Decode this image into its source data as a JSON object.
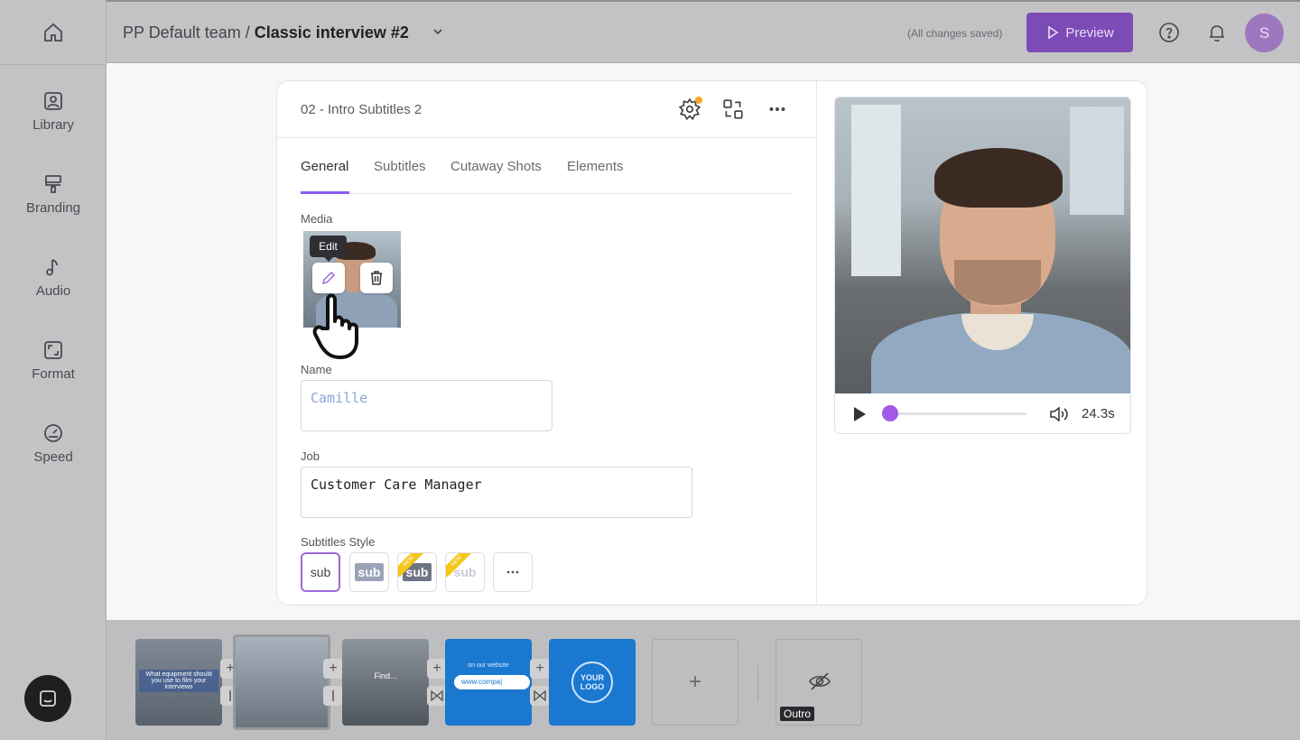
{
  "sidebar": {
    "items": [
      {
        "label": "Library",
        "icon": "image-icon"
      },
      {
        "label": "Branding",
        "icon": "paint-roller-icon"
      },
      {
        "label": "Audio",
        "icon": "music-note-icon"
      },
      {
        "label": "Format",
        "icon": "aspect-ratio-icon"
      },
      {
        "label": "Speed",
        "icon": "speedometer-icon"
      }
    ]
  },
  "header": {
    "team": "PP Default team",
    "separator": " / ",
    "project": "Classic interview #2",
    "saved_status": "(All changes saved)",
    "preview_label": "Preview",
    "avatar_initial": "S"
  },
  "panel": {
    "title": "02 - Intro Subtitles 2",
    "tabs": [
      {
        "label": "General",
        "active": true
      },
      {
        "label": "Subtitles",
        "active": false
      },
      {
        "label": "Cutaway Shots",
        "active": false
      },
      {
        "label": "Elements",
        "active": false
      }
    ],
    "media_label": "Media",
    "edit_tooltip": "Edit",
    "name_label": "Name",
    "name_placeholder": "Camille",
    "job_label": "Job",
    "job_value": "Customer Care Manager",
    "subtitles_style_label": "Subtitles Style",
    "styles": [
      {
        "text": "sub",
        "selected": true,
        "new": false
      },
      {
        "text": "sub",
        "selected": false,
        "new": false
      },
      {
        "text": "sub",
        "selected": false,
        "new": true
      },
      {
        "text": "sub",
        "selected": false,
        "new": true
      }
    ],
    "new_tag": "NEW"
  },
  "player": {
    "time": "24.3s",
    "progress": 0.0
  },
  "timeline": {
    "scene1_text": "What equipment should you use to film your interviews",
    "scene3_text": "Find...",
    "scene4_top": "on our website",
    "scene4_url": "www.compa|",
    "scene5_logo": "YOUR LOGO",
    "outro_label": "Outro"
  },
  "colors": {
    "accent": "#8b5cf6",
    "preview_button": "#7d4bb5",
    "badge": "#f5a623"
  }
}
